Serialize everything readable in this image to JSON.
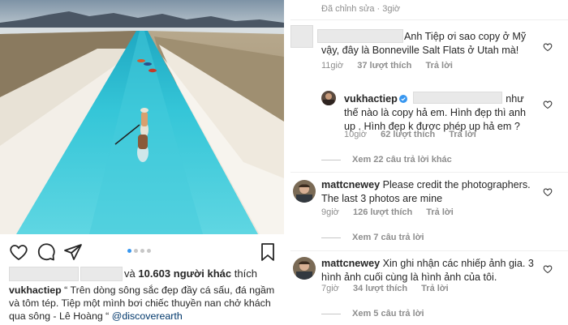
{
  "post": {
    "likes_prefix": "và",
    "likes_count": "10.603",
    "likes_suffix": "người khác",
    "likes_action": "thích",
    "caption_user": "vukhactiep",
    "caption_text": " “ Trên dòng sông sắc đẹp đầy cá sấu, đá ngầm và tôm tép. Tiệp một mình bơi chiếc thuyền nan chở khách qua sông - Lê Hoàng “ ",
    "caption_mention": "@discoverearth",
    "icons": [
      "heart-icon",
      "comment-icon",
      "share-icon",
      "bookmark-icon"
    ],
    "carousel_dots": 4,
    "carousel_active": 1
  },
  "comments": {
    "edited_label": "Đã chỉnh sửa · 3giờ",
    "c1": {
      "text": "Anh Tiệp ơi sao copy ở Mỹ vậy, đây là Bonneville Salt Flats ở Utah mà!",
      "time": "11giờ",
      "likes": "37 lượt thích",
      "reply": "Trả lời"
    },
    "c2": {
      "user": "vukhactiep",
      "text": "như thế nào là copy hả em. Hình đẹp thì anh up . Hình đẹp k được phép up hả em ?",
      "time": "10giờ",
      "likes": "62 lượt thích",
      "reply": "Trả lời"
    },
    "more1": "Xem 22 câu trả lời khác",
    "c3": {
      "user": "mattcnewey",
      "text": "Please credit the photographers. The last 3 photos are mine",
      "time": "9giờ",
      "likes": "126 lượt thích",
      "reply": "Trả lời"
    },
    "more2": "Xem 7 câu trả lời",
    "c4": {
      "user": "mattcnewey",
      "text": "Xin ghi nhận các nhiếp ảnh gia.  3 hình ảnh cuối cùng là hình ảnh của tôi.",
      "time": "7giờ",
      "likes": "34 lượt thích",
      "reply": "Trả lời"
    },
    "more3": "Xem 5 câu trả lời"
  },
  "colors": {
    "water": "#2fc3d6",
    "salt": "#ede7dc",
    "sky": "#9bb0bf",
    "mention": "#00376b",
    "muted": "#8e8e8e"
  }
}
